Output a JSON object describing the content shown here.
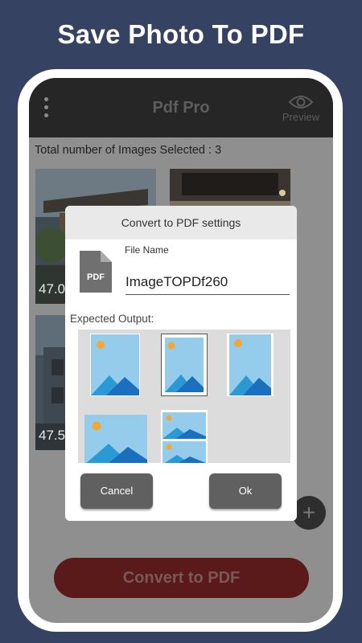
{
  "headline": "Save Photo To PDF",
  "app": {
    "title": "Pdf Pro",
    "preview_label": "Preview",
    "menu_icon": "more-vert-icon",
    "preview_icon": "eye-icon"
  },
  "selection": {
    "count_text": "Total number of Images Selected : 3",
    "thumbnails": [
      {
        "size": "47.0"
      },
      {
        "size": ""
      },
      {
        "size": "47.5"
      }
    ]
  },
  "fab": {
    "icon": "plus-icon"
  },
  "convert_button": "Convert to PDF",
  "dialog": {
    "title": "Convert to PDF settings",
    "file_name_label": "File Name",
    "file_name_value": "ImageTOPDf260",
    "file_icon_text": "PDF",
    "expected_output_label": "Expected Output:",
    "cancel_label": "Cancel",
    "ok_label": "Ok"
  },
  "colors": {
    "background": "#354262",
    "appbar": "#262626",
    "image_sky": "#95cceb",
    "mountain_dark": "#1a6fbe",
    "mountain_light": "#2a99d4",
    "sun": "#f2a833"
  }
}
